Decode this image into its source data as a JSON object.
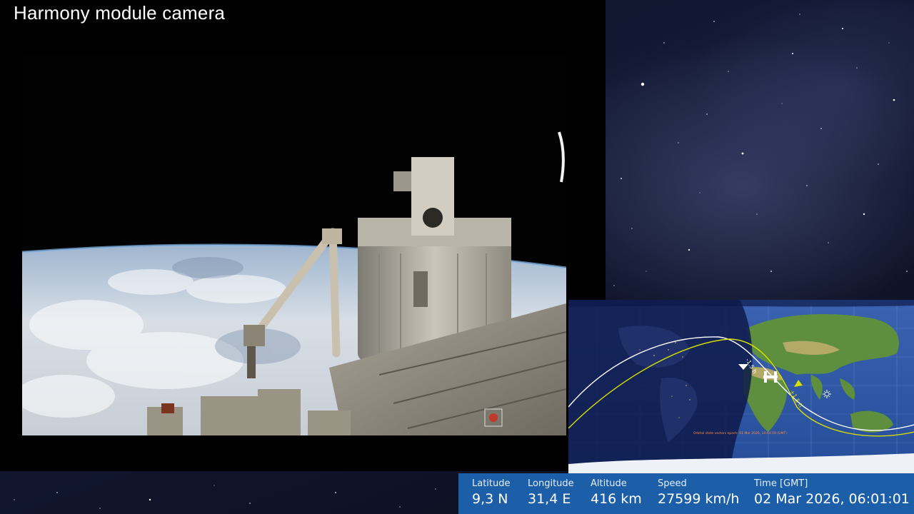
{
  "feed": {
    "title": "Harmony module camera"
  },
  "map": {
    "orbit_note": "Orbital state vectors epoch: 01 Mar 2026, 14:44:59 (GMT)",
    "orbit_marker_prev": "-1.5 h",
    "orbit_marker_next": "+1.5 h",
    "sun_icon": "sun-icon",
    "station_icon": "iss-icon"
  },
  "telemetry": {
    "latitude_label": "Latitude",
    "latitude_value": "9,3 N",
    "longitude_label": "Longitude",
    "longitude_value": "31,4 E",
    "altitude_label": "Altitude",
    "altitude_value": "416 km",
    "speed_label": "Speed",
    "speed_value": "27599 km/h",
    "time_label": "Time [GMT]",
    "time_value": "02 Mar 2026, 06:01:01"
  },
  "colors": {
    "telemetry_bar": "#1c5fa8",
    "orbit_current": "#ffffff",
    "orbit_next": "#d8e000",
    "ocean": "#2a4f9c"
  }
}
